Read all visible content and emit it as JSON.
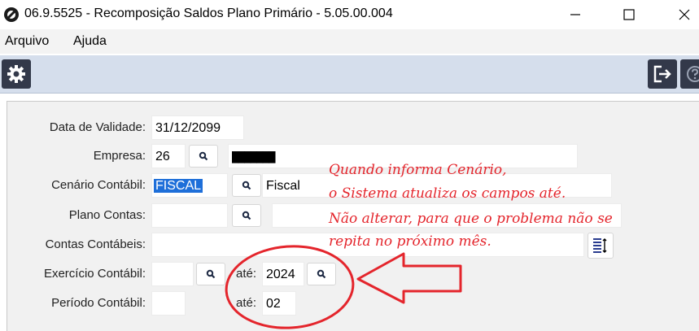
{
  "window": {
    "title": "06.9.5525 - Recomposição Saldos Plano Primário - 5.05.00.004",
    "minimize": "—",
    "maximize": "☐",
    "close": "✕"
  },
  "menu": {
    "items": [
      {
        "label": "Arquivo"
      },
      {
        "label": "Ajuda"
      }
    ]
  },
  "toolbar": {
    "settings_icon": "gear-icon",
    "exit_icon": "exit-icon",
    "help_icon": "help-icon"
  },
  "form": {
    "data_validade": {
      "label": "Data de Validade:",
      "value": "31/12/2099"
    },
    "empresa": {
      "label": "Empresa:",
      "value": "26",
      "name": "███████"
    },
    "cenario": {
      "label": "Cenário Contábil:",
      "value": "FISCAL",
      "description": "Fiscal"
    },
    "plano_contas": {
      "label": "Plano Contas:",
      "value": "",
      "description": ""
    },
    "contas_contabeis": {
      "label": "Contas Contábeis:",
      "value": ""
    },
    "exercicio": {
      "label": "Exercício Contábil:",
      "value": "",
      "ate_label": "até:",
      "ate_value": "2024"
    },
    "periodo": {
      "label": "Período Contábil:",
      "value": "",
      "ate_label": "até:",
      "ate_value": "02"
    }
  },
  "annotation": {
    "lines": [
      "Quando informa Cenário,",
      "o Sistema atualiza os campos até.",
      "Não alterar, para que o problema não se",
      "repita no próximo mês."
    ],
    "color": "#e4252c"
  }
}
